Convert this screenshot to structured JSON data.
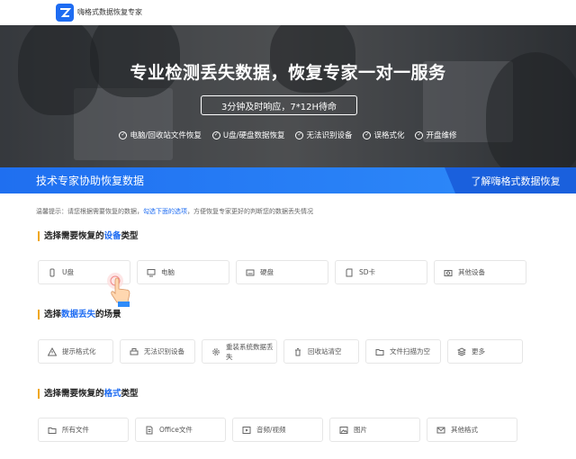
{
  "header": {
    "brand": "嗨格式数据恢复专家"
  },
  "hero": {
    "title": "专业检测丢失数据，恢复专家一对一服务",
    "pill": "3分钟及时响应，7*12H待命",
    "features": [
      "电脑/回收站文件恢复",
      "U盘/硬盘数据恢复",
      "无法识别设备",
      "误格式化",
      "开盘维修"
    ]
  },
  "banner": {
    "left": "技术专家协助恢复数据",
    "right": "了解嗨格式数据恢复"
  },
  "tip": {
    "prefix": "温馨提示：请您根据需要恢复的数据，",
    "link": "勾选下面的选项",
    "suffix": "，方便恢复专家更好的判断您的数据丢失情况"
  },
  "sections": [
    {
      "pre": "选择需要恢复的",
      "hl": "设备",
      "post": "类型",
      "items": [
        {
          "label": "U盘",
          "icon": "usb-icon"
        },
        {
          "label": "电脑",
          "icon": "monitor-icon"
        },
        {
          "label": "硬盘",
          "icon": "hdd-icon"
        },
        {
          "label": "SD卡",
          "icon": "sdcard-icon"
        },
        {
          "label": "其他设备",
          "icon": "camera-icon"
        }
      ]
    },
    {
      "pre": "选择",
      "hl": "数据丢失",
      "post": "的场景",
      "items": [
        {
          "label": "提示格式化",
          "icon": "warning-icon"
        },
        {
          "label": "无法识别设备",
          "icon": "printer-icon"
        },
        {
          "label": "重装系统数据丢失",
          "icon": "gear-icon"
        },
        {
          "label": "回收站清空",
          "icon": "trash-icon"
        },
        {
          "label": "文件扫描为空",
          "icon": "folder-icon"
        },
        {
          "label": "更多",
          "icon": "layers-icon"
        }
      ]
    },
    {
      "pre": "选择需要恢复的",
      "hl": "格式",
      "post": "类型",
      "items": [
        {
          "label": "所有文件",
          "icon": "folder-icon"
        },
        {
          "label": "Office文件",
          "icon": "document-icon"
        },
        {
          "label": "音频/视频",
          "icon": "video-icon"
        },
        {
          "label": "图片",
          "icon": "image-icon"
        },
        {
          "label": "其他格式",
          "icon": "mail-icon"
        }
      ]
    }
  ],
  "colors": {
    "accent": "#1e6cf2",
    "marker": "#f0a81e"
  }
}
